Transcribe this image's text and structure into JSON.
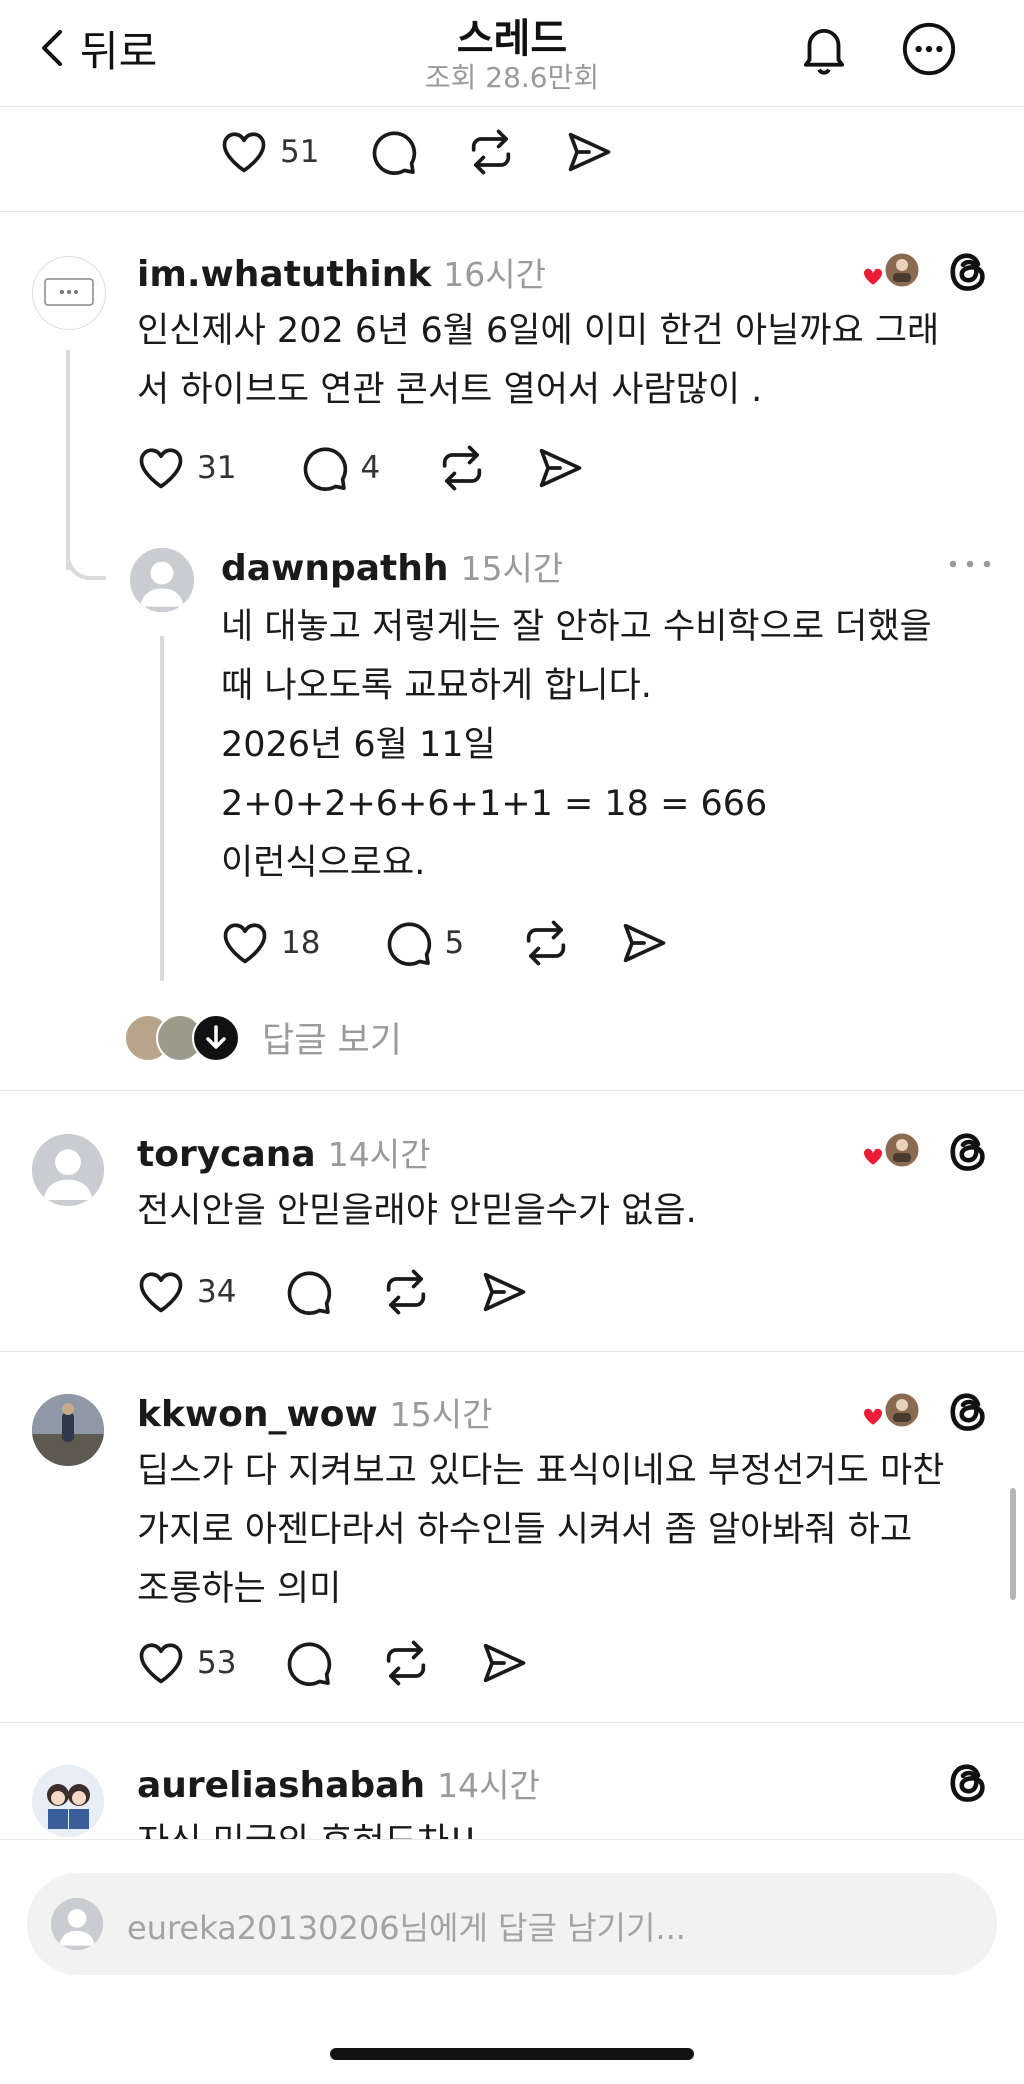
{
  "header": {
    "back_label": "뒤로",
    "title": "스레드",
    "views": "조회 28.6만회"
  },
  "top_post": {
    "likes": "51"
  },
  "replies": [
    {
      "username": "im.whatuthink",
      "time": "16시간",
      "lines": [
        "인신제사 202  6년 6월 6일에 이미 한건 아닐까요 그래",
        "서 하이브도 연관 콘서트 열어서 사람많이 ."
      ],
      "likes": "31",
      "comments": "4"
    },
    {
      "username": "dawnpathh",
      "time": "15시간",
      "lines": [
        "네 대놓고 저렇게는 잘 안하고 수비학으로 더했을",
        "때 나오도록 교묘하게 합니다.",
        "2026년 6월 11일",
        "2+0+2+6+6+1+1 = 18 = 666",
        "이런식으로요."
      ],
      "likes": "18",
      "comments": "5"
    },
    {
      "username": "torycana",
      "time": "14시간",
      "lines": [
        "전시안을 안믿을래야 안믿을수가 없음."
      ],
      "likes": "34"
    },
    {
      "username": "kkwon_wow",
      "time": "15시간",
      "lines": [
        "딥스가 다 지켜보고 있다는 표식이네요 부정선거도 마찬",
        "가지로 아젠다라서 하수인들 시켜서 좀 알아봐줘 하고",
        "조롱하는 의미"
      ],
      "likes": "53"
    },
    {
      "username": "aureliashabah",
      "time": "14시간",
      "lines": [
        "자신 미국의 후혀도차!!"
      ]
    }
  ],
  "view_replies_label": "답글 보기",
  "composer": {
    "placeholder": "eureka20130206님에게 답글 남기기..."
  },
  "icons": [
    "back-chevron-icon",
    "bell-icon",
    "more-icon",
    "heart-icon",
    "comment-icon",
    "repost-icon",
    "share-icon",
    "threads-icon"
  ],
  "colors": {
    "heart_red": "#ee1d36",
    "muted": "#9a9a9a",
    "divider": "#e6e6e6"
  }
}
